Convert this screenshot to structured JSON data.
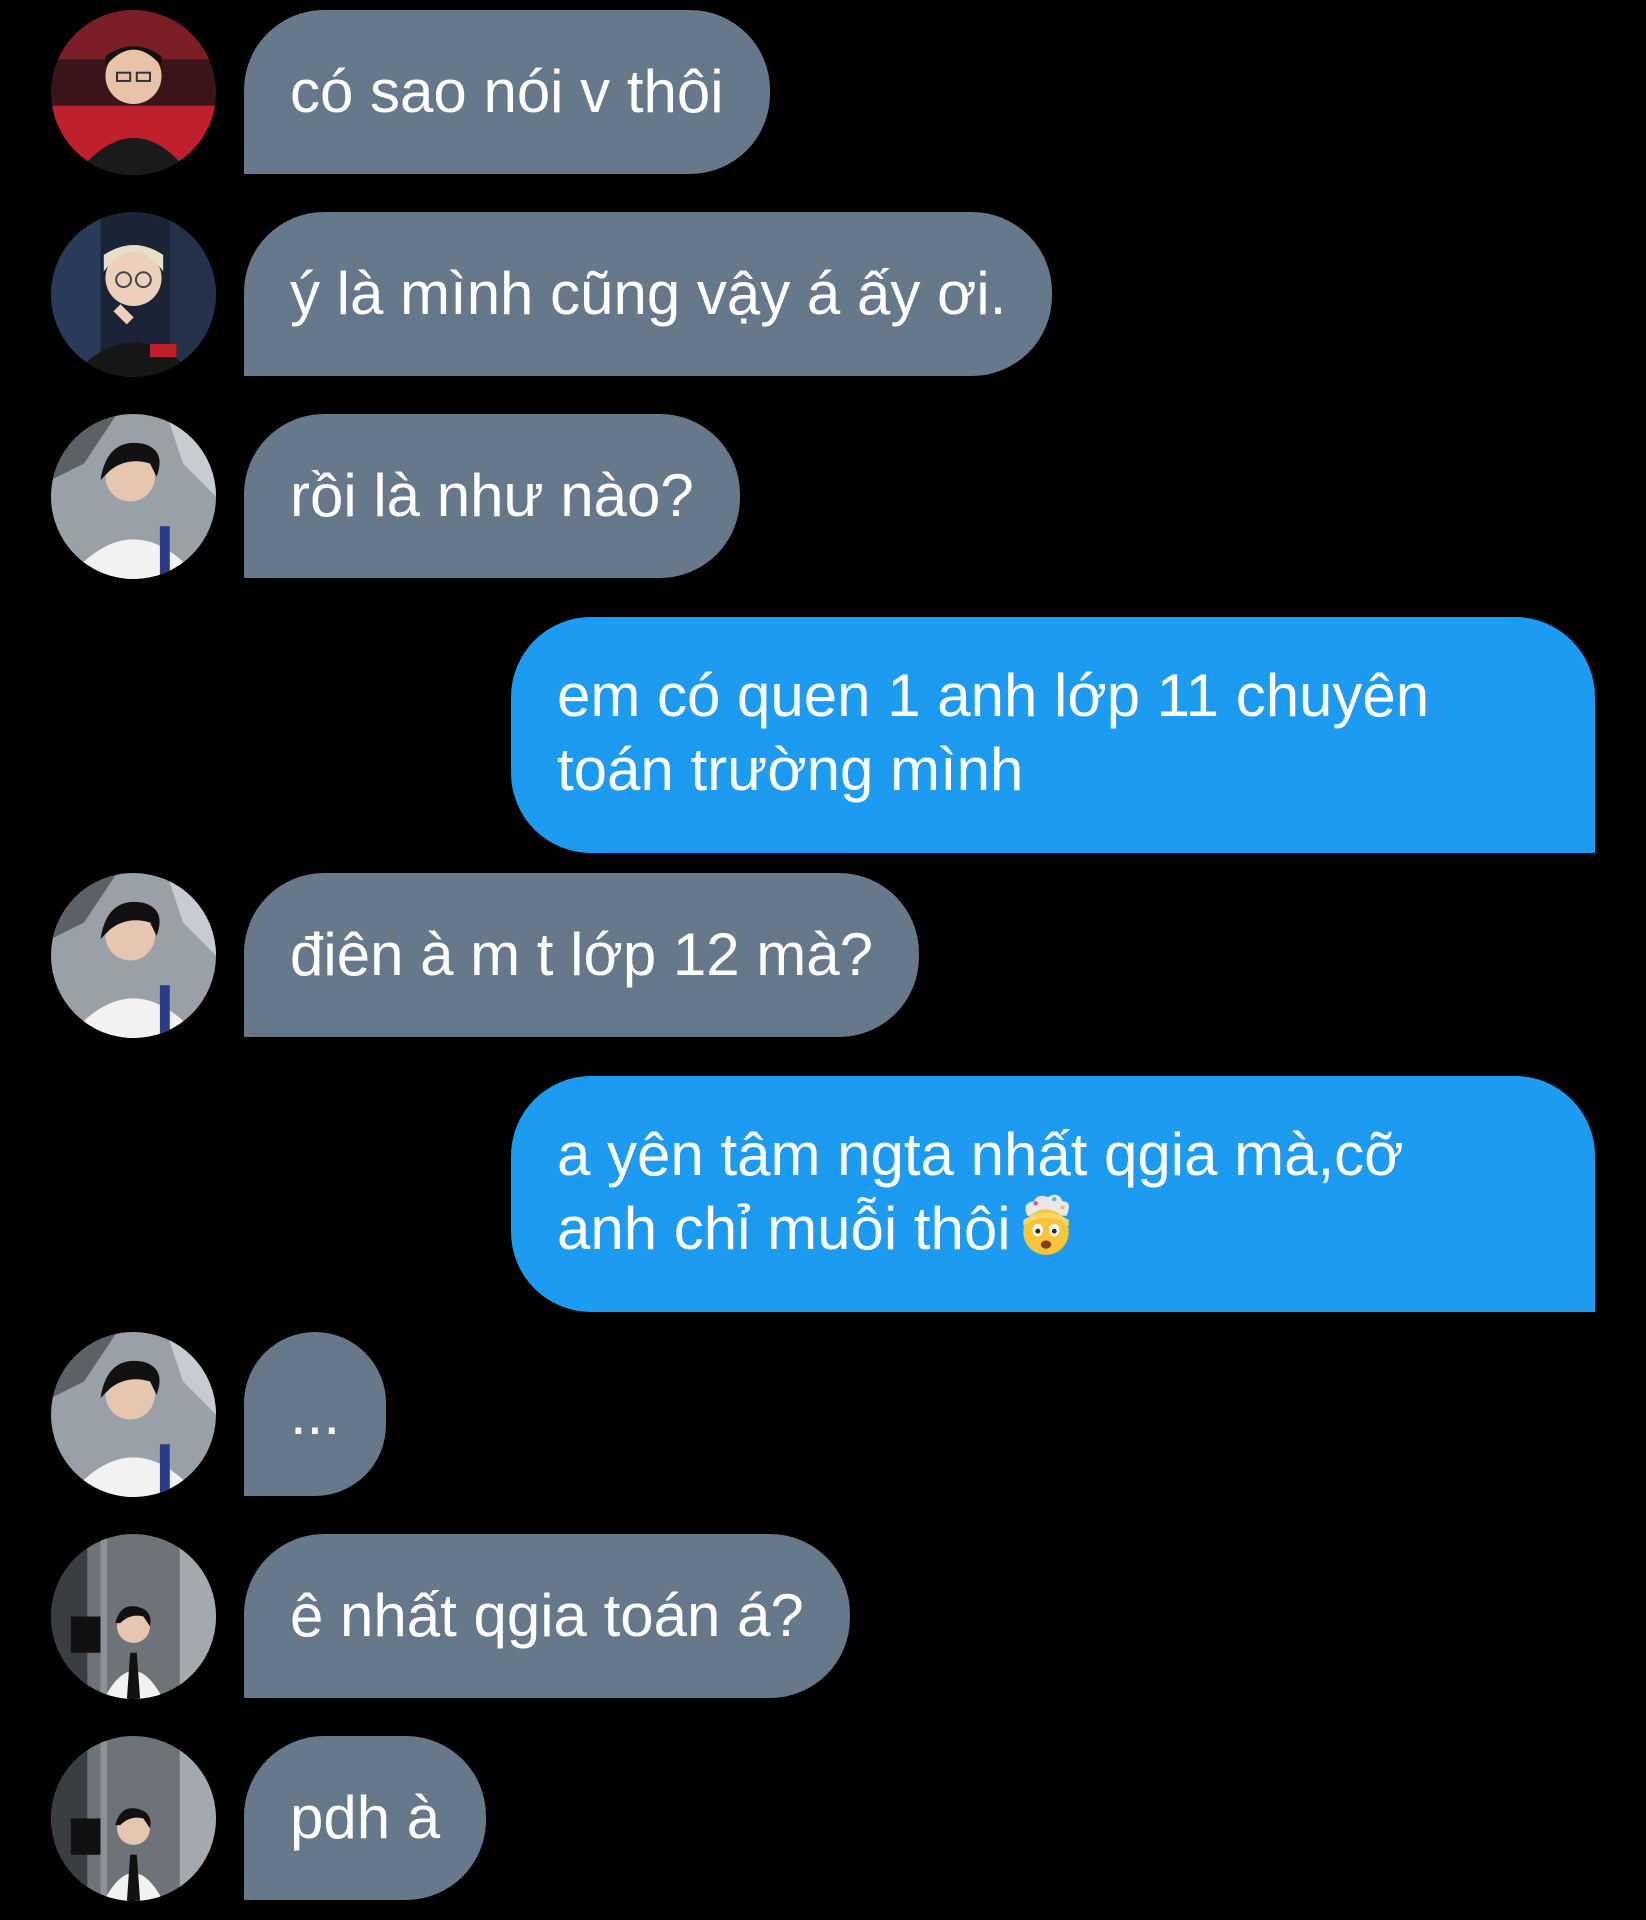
{
  "messages": [
    {
      "direction": "received",
      "avatar": "red-jersey-avatar",
      "text": "có sao nói v thôi"
    },
    {
      "direction": "received",
      "avatar": "blond-glasses-avatar",
      "text": "ý là mình cũng vậy á ấy ơi."
    },
    {
      "direction": "received",
      "avatar": "white-jacket-avatar",
      "text": "rồi là như nào?"
    },
    {
      "direction": "sent",
      "lines": [
        "em có quen 1 anh lớp 11 chuyên",
        "toán trường mình"
      ]
    },
    {
      "direction": "received",
      "avatar": "white-jacket-avatar",
      "text": "điên à m t lớp 12 mà?"
    },
    {
      "direction": "sent",
      "lines": [
        "a yên tâm ngta nhất qgia mà,cỡ",
        "anh chỉ muỗi thôi"
      ],
      "emoji": "exploding-head-emoji"
    },
    {
      "direction": "received",
      "avatar": "white-jacket-avatar",
      "text": "..."
    },
    {
      "direction": "received",
      "avatar": "suit-tie-avatar",
      "text": "ê nhất qgia toán á?"
    },
    {
      "direction": "received",
      "avatar": "suit-tie-avatar",
      "text": "pdh à"
    }
  ],
  "colors": {
    "background": "#000000",
    "received_bubble": "#66788a",
    "sent_bubble": "#1d9bf0",
    "text": "#ffffff"
  }
}
